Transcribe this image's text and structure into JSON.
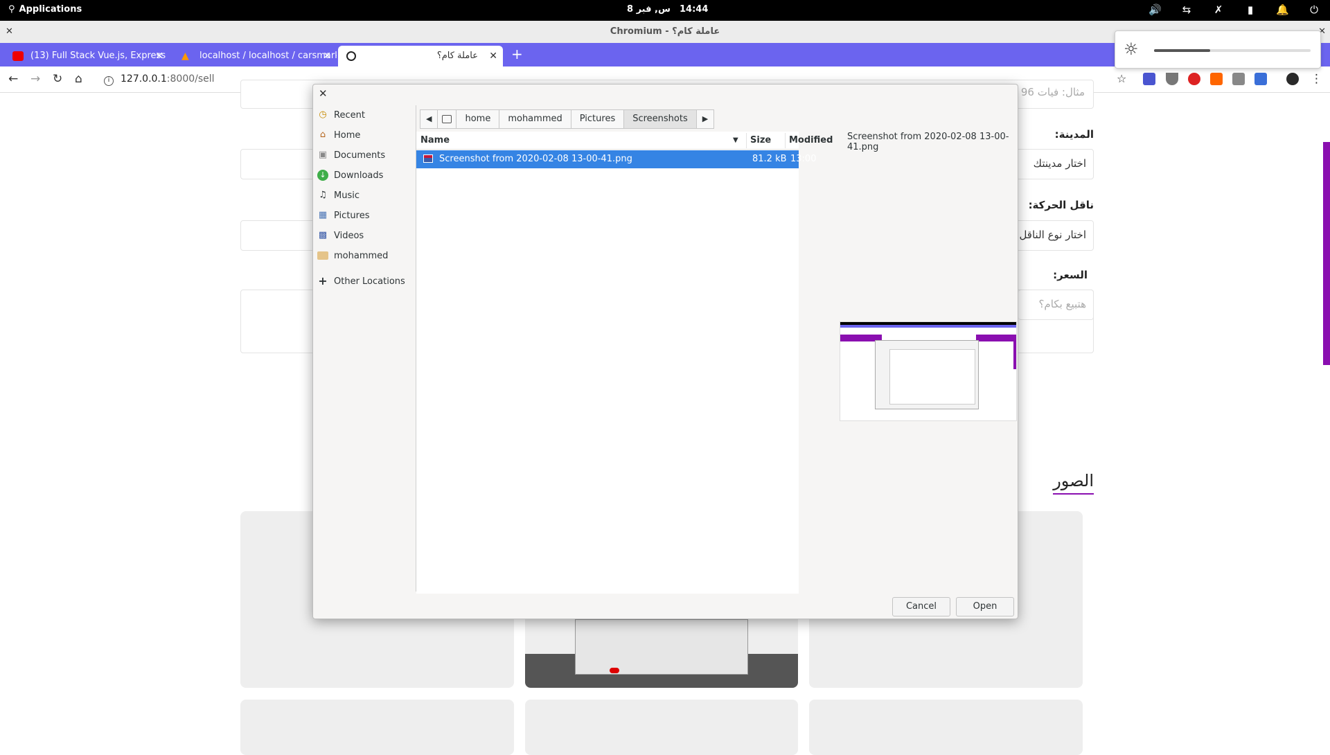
{
  "topbar": {
    "applications": "Applications",
    "date": "س, فبر 8",
    "time": "14:44"
  },
  "window": {
    "title": "Chromium - عاملة كام؟"
  },
  "tabs": [
    {
      "title": "(13) Full Stack Vue.js, Express &",
      "icon": "youtube-icon"
    },
    {
      "title": "localhost / localhost / carsmark",
      "icon": "phpmyadmin-icon"
    },
    {
      "title": "عاملة كام؟",
      "icon": "globe-icon"
    }
  ],
  "address": {
    "url_host": "127.0.0.1",
    "url_rest": ":8000/sell"
  },
  "page": {
    "city_label": "المدينة:",
    "city_placeholder": "اختار مدينتك",
    "transmission_label": "ناقل الحركة:",
    "transmission_placeholder": "اختار نوع الناقل",
    "price_label": "السعر:",
    "price_placeholder": "هتبيع بكام؟",
    "partial_placeholder": "مثال: فيات 96",
    "photos_heading": "الصور"
  },
  "brightness": {
    "level": 0.36
  },
  "dialog": {
    "sidebar": [
      {
        "label": "Recent",
        "icon": "recent-icon"
      },
      {
        "label": "Home",
        "icon": "home-icon"
      },
      {
        "label": "Documents",
        "icon": "documents-icon"
      },
      {
        "label": "Downloads",
        "icon": "downloads-icon"
      },
      {
        "label": "Music",
        "icon": "music-icon"
      },
      {
        "label": "Pictures",
        "icon": "pictures-icon"
      },
      {
        "label": "Videos",
        "icon": "videos-icon"
      },
      {
        "label": "mohammed",
        "icon": "folder-icon"
      },
      {
        "label": "Other Locations",
        "icon": "plus-icon"
      }
    ],
    "path": [
      "home",
      "mohammed",
      "Pictures",
      "Screenshots"
    ],
    "columns": {
      "name": "Name",
      "size": "Size",
      "modified": "Modified"
    },
    "files": [
      {
        "name": "Screenshot from 2020-02-08 13-00-41.png",
        "size": "81.2 kB",
        "modified": "13:00"
      }
    ],
    "preview_name": "Screenshot from 2020-02-08 13-00-41.png",
    "cancel": "Cancel",
    "open": "Open"
  },
  "colors": {
    "tabbar": "#6b64ef",
    "selection": "#3584e4",
    "accent_purple": "#8a0fb0"
  }
}
